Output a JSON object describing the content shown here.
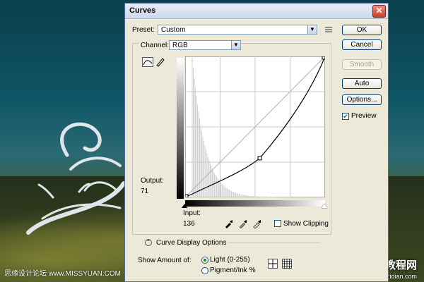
{
  "dialog": {
    "title": "Curves",
    "close": "✕",
    "preset_label": "Preset:",
    "preset_value": "Custom",
    "channel_label": "Channel:",
    "channel_value": "RGB",
    "buttons": {
      "ok": "OK",
      "cancel": "Cancel",
      "smooth": "Smooth",
      "auto": "Auto",
      "options": "Options..."
    },
    "preview_label": "Preview",
    "preview_checked": true,
    "output_label": "Output:",
    "output_value": "71",
    "input_label": "Input:",
    "input_value": "136",
    "show_clipping_label": "Show Clipping",
    "show_clipping_checked": false,
    "curve_display_options": "Curve Display Options",
    "show_amount_label": "Show Amount of:",
    "radio_light": "Light  (0-255)",
    "radio_pigment": "Pigment/Ink %",
    "selected_radio": "light"
  },
  "curve": {
    "points": [
      [
        0,
        0
      ],
      [
        136,
        71
      ],
      [
        255,
        255
      ]
    ],
    "selected_point": [
      136,
      71
    ]
  },
  "watermark": {
    "left": "思缘设计论坛 www.MISSYUAN.COM",
    "right_main": "查字典 教程网",
    "right_sub": "jiaocheng.chazidian.com"
  }
}
